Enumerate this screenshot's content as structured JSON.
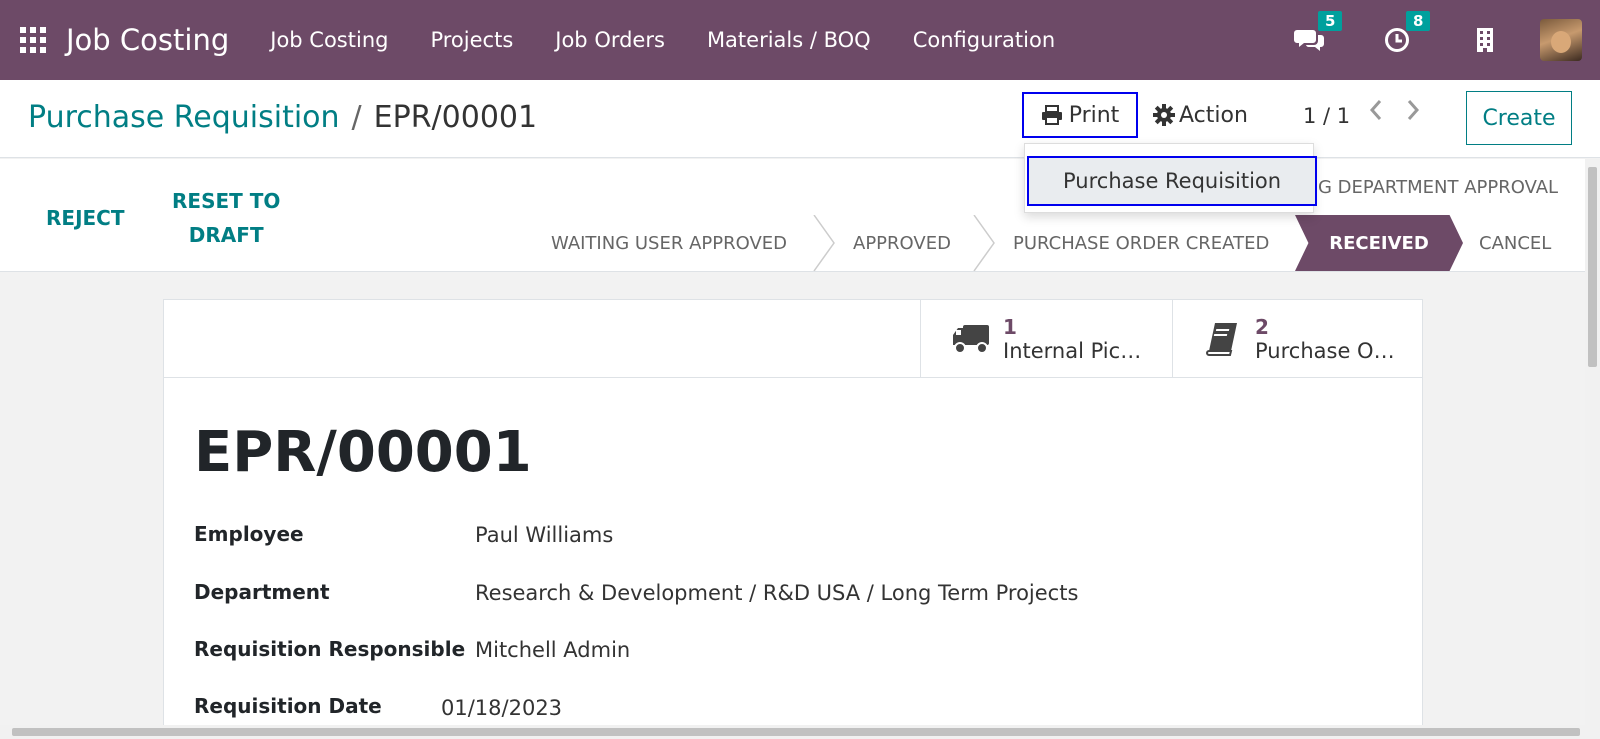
{
  "navbar": {
    "brand": "Job Costing",
    "menu": [
      "Job Costing",
      "Projects",
      "Job Orders",
      "Materials / BOQ",
      "Configuration"
    ],
    "messages_count": "5",
    "activities_count": "8"
  },
  "control_panel": {
    "breadcrumb_parent": "Purchase Requisition",
    "breadcrumb_sep": "/",
    "breadcrumb_current": "EPR/00001",
    "print_label": "Print",
    "action_label": "Action",
    "pager": "1 / 1",
    "create_label": "Create"
  },
  "dropdown": {
    "item": "Purchase Requisition"
  },
  "statusbar": {
    "reject_label": "REJECT",
    "reset_line1": "RESET TO",
    "reset_line2": "DRAFT",
    "top_stage_partial": "G DEPARTMENT APPROVAL",
    "stages": [
      "WAITING USER APPROVED",
      "APPROVED",
      "PURCHASE ORDER CREATED",
      "RECEIVED",
      "CANCEL"
    ],
    "active_stage": "RECEIVED"
  },
  "smart_buttons": [
    {
      "count": "1",
      "label": "Internal Pic…",
      "icon": "truck-icon"
    },
    {
      "count": "2",
      "label": "Purchase O…",
      "icon": "book-icon"
    }
  ],
  "form": {
    "title": "EPR/00001",
    "fields": [
      {
        "label": "Employee",
        "value": "Paul Williams"
      },
      {
        "label": "Department",
        "value": "Research & Development / R&D USA / Long Term Projects"
      },
      {
        "label": "Requisition Responsible",
        "value": "Mitchell Admin"
      },
      {
        "label": "Requisition Date",
        "value": "01/18/2023"
      }
    ]
  },
  "colors": {
    "navbar": "#6d4a67",
    "accent": "#017e84",
    "badge": "#00a09d",
    "highlight_border": "#0000ee"
  }
}
